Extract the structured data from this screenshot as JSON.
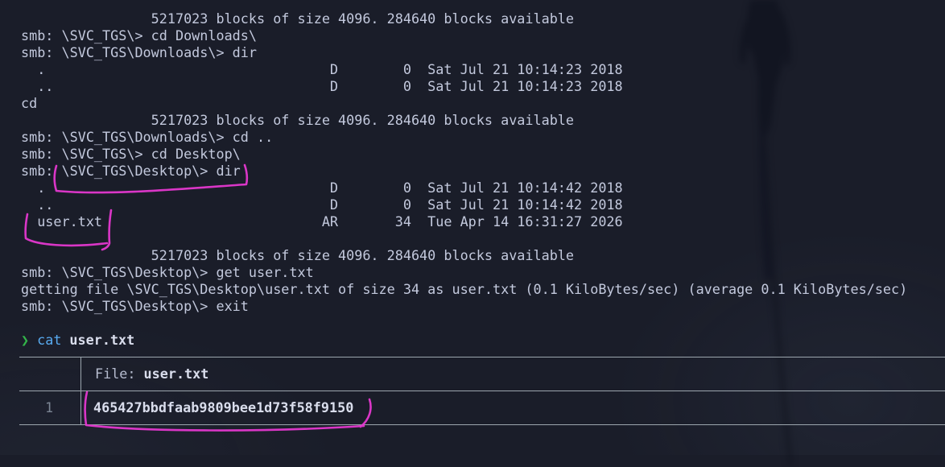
{
  "terminal": {
    "smb_lines": [
      "                5217023 blocks of size 4096. 284640 blocks available",
      "smb: \\SVC_TGS\\> cd Downloads\\",
      "smb: \\SVC_TGS\\Downloads\\> dir",
      "  .                                   D        0  Sat Jul 21 10:14:23 2018",
      "  ..                                  D        0  Sat Jul 21 10:14:23 2018",
      "cd",
      "                5217023 blocks of size 4096. 284640 blocks available",
      "smb: \\SVC_TGS\\Downloads\\> cd ..",
      "smb: \\SVC_TGS\\> cd Desktop\\",
      "smb: \\SVC_TGS\\Desktop\\> dir",
      "  .                                   D        0  Sat Jul 21 10:14:42 2018",
      "  ..                                  D        0  Sat Jul 21 10:14:42 2018",
      "  user.txt                           AR       34  Tue Apr 14 16:31:27 2026",
      "",
      "                5217023 blocks of size 4096. 284640 blocks available",
      "smb: \\SVC_TGS\\Desktop\\> get user.txt",
      "getting file \\SVC_TGS\\Desktop\\user.txt of size 34 as user.txt (0.1 KiloBytes/sec) (average 0.1 KiloBytes/sec)",
      "smb: \\SVC_TGS\\Desktop\\> exit",
      ""
    ],
    "prompt": {
      "symbol": "❯",
      "command": "cat",
      "argument": "user.txt"
    }
  },
  "file_viewer": {
    "file_label": "File:",
    "file_name": "user.txt",
    "rows": [
      {
        "line_number": "1",
        "content": "465427bbdfaab9809bee1d73f58f9150"
      }
    ]
  },
  "annotations": {
    "items": [
      "dir-command-circled",
      "user-txt-file-circled",
      "user-flag-hash-circled"
    ]
  },
  "colors": {
    "background": "#1a1d29",
    "foreground": "#c3c9dd",
    "bold_foreground": "#d9ddec",
    "label_foreground": "#b6bccf",
    "prompt_green": "#33b54a",
    "command_blue": "#58aaf0",
    "rule_gray": "#9ca6ae",
    "line_number_gray": "#7b8594",
    "annotation_pink": "#e538d0"
  }
}
